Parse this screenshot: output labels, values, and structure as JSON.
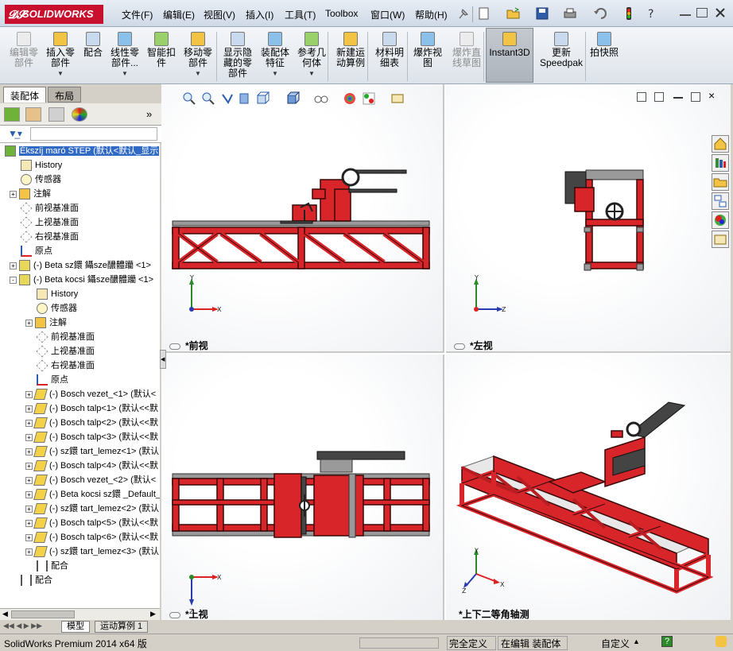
{
  "app": {
    "logo": "SOLIDWORKS",
    "menu": [
      "文件(F)",
      "编辑(E)",
      "视图(V)",
      "插入(I)",
      "工具(T)",
      "Toolbox",
      "窗口(W)",
      "帮助(H)"
    ]
  },
  "ribbon": {
    "buttons": [
      {
        "label": "编辑零\n部件",
        "disabled": true
      },
      {
        "label": "插入零\n部件",
        "dropdown": true
      },
      {
        "label": "配合"
      },
      {
        "label": "线性零\n部件...",
        "dropdown": true
      },
      {
        "label": "智能扣\n件"
      },
      {
        "label": "移动零\n部件",
        "dropdown": true
      },
      {
        "label": "显示隐\n藏的零\n部件"
      },
      {
        "label": "装配体\n特征",
        "dropdown": true
      },
      {
        "label": "参考几\n何体",
        "dropdown": true
      },
      {
        "label": "新建运\n动算例"
      },
      {
        "label": "材料明\n细表"
      },
      {
        "label": "爆炸视\n图"
      },
      {
        "label": "爆炸直\n线草图",
        "disabled": true
      },
      {
        "label": "Instant3D",
        "active": true
      },
      {
        "label": "更新\nSpeedpak"
      },
      {
        "label": "拍快照"
      }
    ]
  },
  "left_panel": {
    "tabs": [
      "装配体",
      "布局"
    ],
    "tree": [
      {
        "label": "Ékszíj maró STEP  (默认<默认_显示",
        "level": 0,
        "icon": "assembly",
        "selected": true
      },
      {
        "label": "History",
        "level": 1,
        "icon": "history"
      },
      {
        "label": "传感器",
        "level": 1,
        "icon": "sensor"
      },
      {
        "label": "注解",
        "level": 1,
        "icon": "annotation",
        "expand": "+"
      },
      {
        "label": "前视基准面",
        "level": 1,
        "icon": "plane"
      },
      {
        "label": "上视基准面",
        "level": 1,
        "icon": "plane"
      },
      {
        "label": "右视基准面",
        "level": 1,
        "icon": "plane"
      },
      {
        "label": "原点",
        "level": 1,
        "icon": "origin"
      },
      {
        "label": "(-) Beta sz鐶 鑷sze醲體躪 <1>",
        "level": 1,
        "icon": "subassembly",
        "expand": "+"
      },
      {
        "label": "(-) Beta kocsi 鑷sze醲體躪 <1>",
        "level": 1,
        "icon": "subassembly",
        "expand": "-"
      },
      {
        "label": "History",
        "level": 2,
        "icon": "history"
      },
      {
        "label": "传感器",
        "level": 2,
        "icon": "sensor"
      },
      {
        "label": "注解",
        "level": 2,
        "icon": "annotation",
        "expand": "+"
      },
      {
        "label": "前视基准面",
        "level": 2,
        "icon": "plane"
      },
      {
        "label": "上视基准面",
        "level": 2,
        "icon": "plane"
      },
      {
        "label": "右视基准面",
        "level": 2,
        "icon": "plane"
      },
      {
        "label": "原点",
        "level": 2,
        "icon": "origin"
      },
      {
        "label": "(-) Bosch vezet_<1> (默认<",
        "level": 2,
        "icon": "part",
        "expand": "+"
      },
      {
        "label": "(-) Bosch talp<1> (默认<<默",
        "level": 2,
        "icon": "part",
        "expand": "+"
      },
      {
        "label": "(-) Bosch talp<2> (默认<<默",
        "level": 2,
        "icon": "part",
        "expand": "+"
      },
      {
        "label": "(-) Bosch talp<3> (默认<<默",
        "level": 2,
        "icon": "part",
        "expand": "+"
      },
      {
        "label": "(-) sz鐶 tart_lemez<1> (默认",
        "level": 2,
        "icon": "part",
        "expand": "+"
      },
      {
        "label": "(-) Bosch talp<4> (默认<<默",
        "level": 2,
        "icon": "part",
        "expand": "+"
      },
      {
        "label": "(-) Bosch vezet_<2> (默认<",
        "level": 2,
        "icon": "part",
        "expand": "+"
      },
      {
        "label": "(-) Beta kocsi sz鐶 _Default_/",
        "level": 2,
        "icon": "part",
        "expand": "+"
      },
      {
        "label": "(-) sz鐶 tart_lemez<2> (默认",
        "level": 2,
        "icon": "part",
        "expand": "+"
      },
      {
        "label": "(-) Bosch talp<5> (默认<<默",
        "level": 2,
        "icon": "part",
        "expand": "+"
      },
      {
        "label": "(-) Bosch talp<6> (默认<<默",
        "level": 2,
        "icon": "part",
        "expand": "+"
      },
      {
        "label": "(-) sz鐶 tart_lemez<3> (默认",
        "level": 2,
        "icon": "part",
        "expand": "+"
      },
      {
        "label": "配合",
        "level": 2,
        "icon": "mates"
      },
      {
        "label": "配合",
        "level": 1,
        "icon": "mates"
      }
    ],
    "bottom_tabs": [
      "模型",
      "运动算例 1"
    ]
  },
  "viewports": [
    {
      "label": "*前视",
      "axes": [
        "Y",
        "X"
      ]
    },
    {
      "label": "*左视",
      "axes": [
        "Y",
        "Z"
      ]
    },
    {
      "label": "*上视",
      "axes": [
        "X",
        "Z"
      ]
    },
    {
      "label": "*上下二等角轴测",
      "axes": [
        "Y",
        "X",
        "Z"
      ]
    }
  ],
  "status": {
    "app_name": "SolidWorks Premium 2014 x64 版",
    "state": "完全定义",
    "mode": "在编辑 装配体",
    "custom": "自定义"
  },
  "colors": {
    "frame": "#d8252a",
    "selection": "#316ac5",
    "logo_bg": "#c8102e"
  }
}
